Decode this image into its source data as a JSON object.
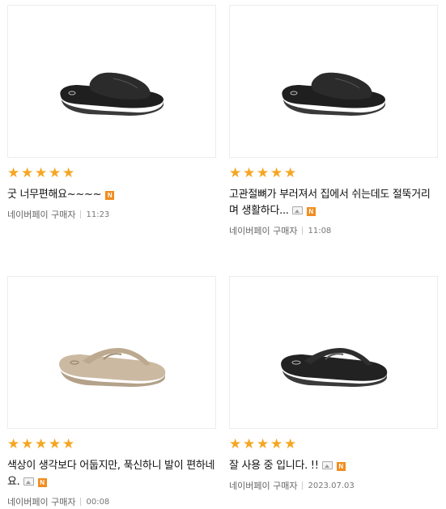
{
  "reviews": [
    {
      "product_icon": "black-slide-sandal",
      "rating": 5,
      "text": "굿 너무편해요~~~~",
      "has_photo_badge": false,
      "has_n_badge": true,
      "n_badge": "N",
      "author": "네이버페이 구매자",
      "time": "11:23"
    },
    {
      "product_icon": "black-slide-sandal",
      "rating": 5,
      "text": "고관절뼈가 부러져서 집에서 쉬는데도 절뚝거리며 생활하다...",
      "has_photo_badge": true,
      "has_n_badge": true,
      "n_badge": "N",
      "author": "네이버페이 구매자",
      "time": "11:08"
    },
    {
      "product_icon": "beige-flip-flop",
      "rating": 5,
      "text": "색상이 생각보다 어둡지만, 푹신하니 발이 편하네요.",
      "has_photo_badge": true,
      "has_n_badge": true,
      "n_badge": "N",
      "author": "네이버페이 구매자",
      "time": "00:08"
    },
    {
      "product_icon": "black-flip-flop",
      "rating": 5,
      "text": "잘 사용 중 입니다. !!",
      "has_photo_badge": true,
      "has_n_badge": true,
      "n_badge": "N",
      "author": "네이버페이 구매자",
      "time": "2023.07.03"
    }
  ],
  "star_glyph": "★",
  "colors": {
    "star": "#f5a623",
    "n_badge": "#f08d20",
    "black_sandal": "#2b2b2b",
    "beige_sandal": "#cbb9a1"
  }
}
